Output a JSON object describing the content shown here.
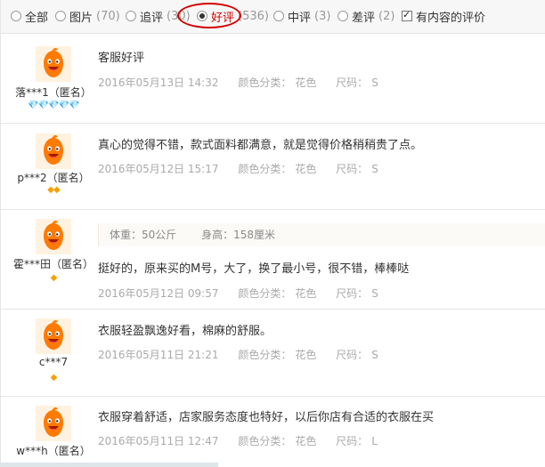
{
  "filters": [
    {
      "label": "全部",
      "count": "",
      "type": "radio",
      "active": false
    },
    {
      "label": "图片",
      "count": "(70)",
      "type": "radio",
      "active": false
    },
    {
      "label": "追评",
      "count": "(30)",
      "type": "radio",
      "active": false
    },
    {
      "label": "好评",
      "count": "(536)",
      "type": "radio",
      "active": true
    },
    {
      "label": "中评",
      "count": "(3)",
      "type": "radio",
      "active": false
    },
    {
      "label": "差评",
      "count": "(2)",
      "type": "radio",
      "active": false
    },
    {
      "label": "有内容的评价",
      "count": "",
      "type": "checkbox",
      "active": true
    }
  ],
  "reviews": [
    {
      "user": "落***1（匿名）",
      "rank": "💎💎💎💎💎",
      "content": "客服好评",
      "date": "2016年05月13日 14:32",
      "color_label": "颜色分类：",
      "color": "花色",
      "size_label": "尺码：",
      "size": "S"
    },
    {
      "user": "p***2（匿名）",
      "rank": "◆◆",
      "content": "真心的觉得不错，款式面料都满意，就是觉得价格稍稍贵了点。",
      "date": "2016年05月12日 15:17",
      "color_label": "颜色分类：",
      "color": "花色",
      "size_label": "尺码：",
      "size": "S"
    },
    {
      "user": "霍***田（匿名）",
      "rank": "◆",
      "weight": "体重：50公斤",
      "height": "身高：158厘米",
      "content": "挺好的，原来买的M号，大了，换了最小号，很不错，棒棒哒",
      "date": "2016年05月12日 09:57",
      "color_label": "颜色分类：",
      "color": "花色",
      "size_label": "尺码：",
      "size": "S"
    },
    {
      "user": "c***7",
      "rank": "◆",
      "content": "衣服轻盈飘逸好看，棉麻的舒服。",
      "date": "2016年05月11日 21:21",
      "color_label": "颜色分类：",
      "color": "花色",
      "size_label": "尺码：",
      "size": "S"
    },
    {
      "user": "w***h（匿名）",
      "rank": "",
      "content": "衣服穿着舒适，店家服务态度也特好，以后你店有合适的衣服在买",
      "date": "2016年05月11日 12:47",
      "color_label": "颜色分类：",
      "color": "花色",
      "size_label": "尺码：",
      "size": "L"
    }
  ]
}
